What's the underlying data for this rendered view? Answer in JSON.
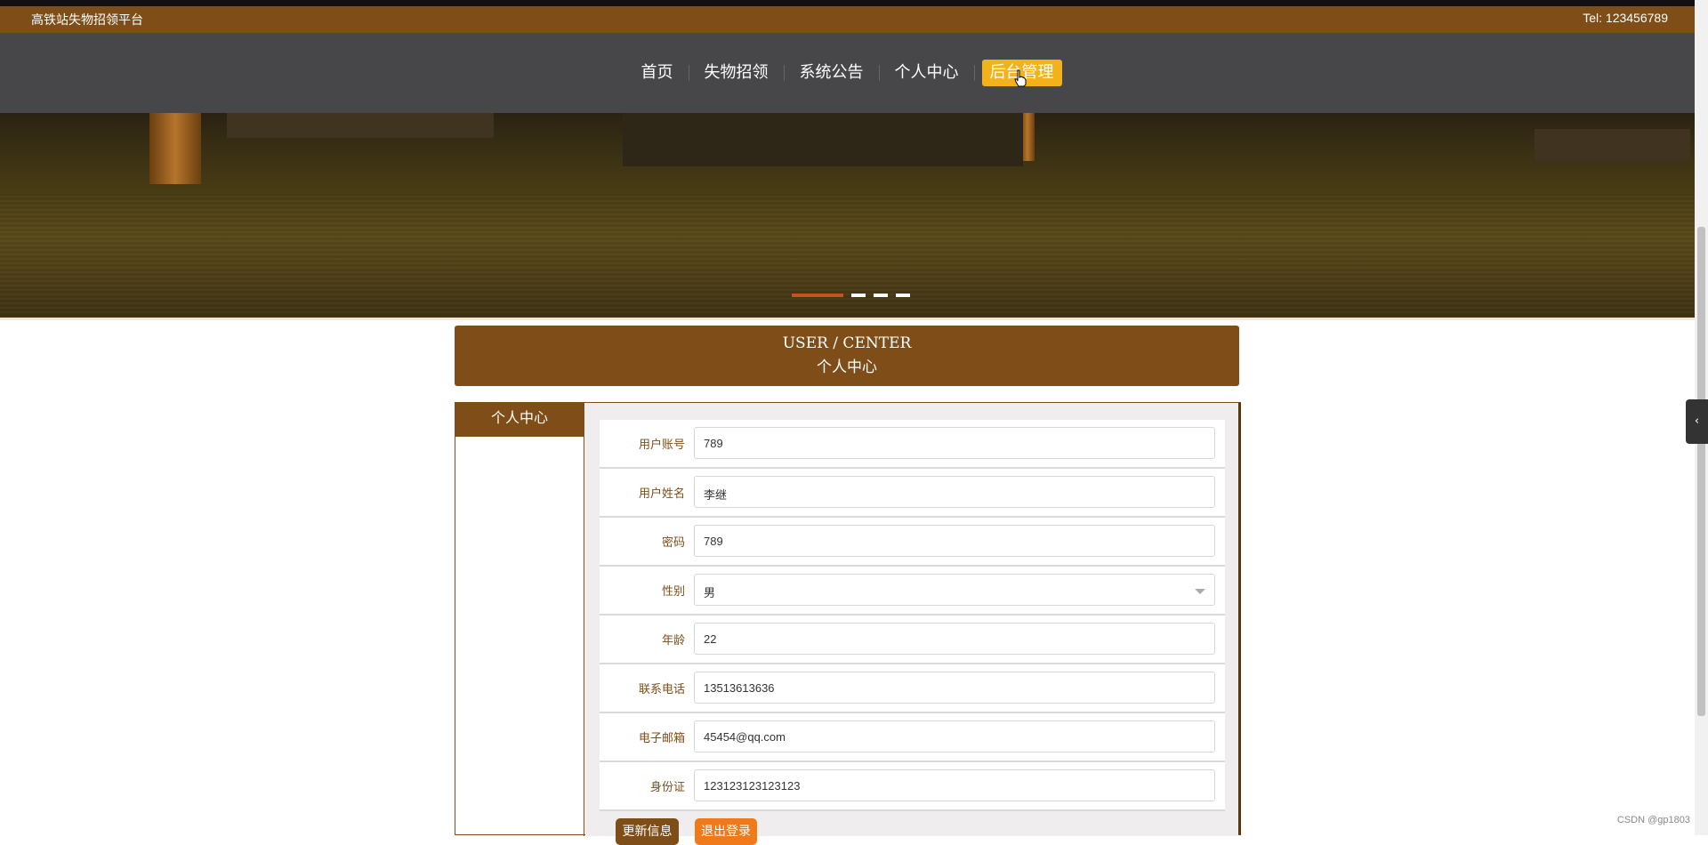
{
  "topbar": {
    "site_name": "高铁站失物招领平台",
    "tel": "Tel:  123456789"
  },
  "nav": {
    "items": [
      "首页",
      "失物招领",
      "系统公告",
      "个人中心",
      "后台管理"
    ],
    "active_index": 4
  },
  "banner": {
    "slides": 4,
    "active_slide": 0
  },
  "header": {
    "title_en": "USER / CENTER",
    "title_zh": "个人中心"
  },
  "sidebar": {
    "title": "个人中心"
  },
  "form": {
    "fields": [
      {
        "label": "用户账号",
        "value": "789"
      },
      {
        "label": "用户姓名",
        "value": "李继"
      },
      {
        "label": "密码",
        "value": "789"
      },
      {
        "label": "性别",
        "value": "男",
        "type": "select"
      },
      {
        "label": "年龄",
        "value": "22"
      },
      {
        "label": "联系电话",
        "value": "13513613636"
      },
      {
        "label": "电子邮箱",
        "value": "45454@qq.com"
      },
      {
        "label": "身份证",
        "value": "123123123123123"
      }
    ]
  },
  "buttons": {
    "update": "更新信息",
    "logout": "退出登录"
  },
  "watermark": "CSDN @gp1803",
  "colors": {
    "brand": "#7f4e18",
    "nav_bg": "#47474a",
    "active": "#f3b21b",
    "logout": "#f0791a"
  }
}
